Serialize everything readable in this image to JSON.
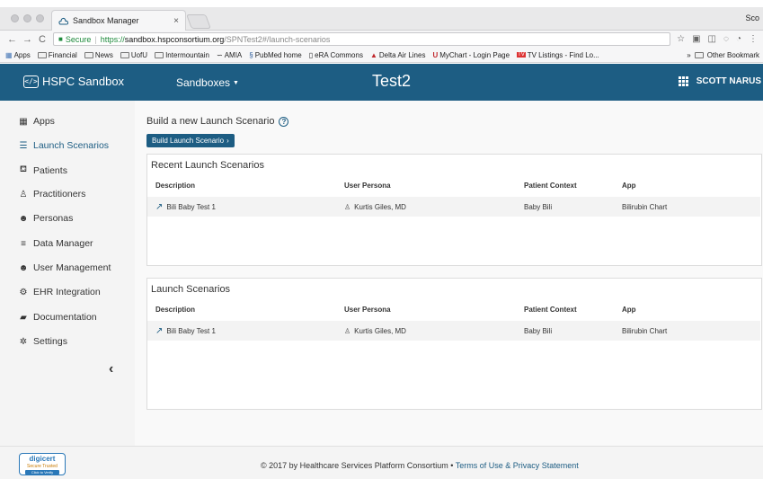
{
  "browser": {
    "tab_title": "Sandbox Manager",
    "tab_close": "×",
    "profile_label": "Sco",
    "nav": {
      "back": "←",
      "forward": "→",
      "reload": "C"
    },
    "address": {
      "secure_label": "Secure",
      "scheme": "https://",
      "host": "sandbox.hspconsortium.org",
      "path": "/SPNTest2#/launch-scenarios"
    },
    "bookmarks": [
      {
        "label": "Apps",
        "icon": "apps-grid-icon"
      },
      {
        "label": "Financial",
        "icon": "folder-icon"
      },
      {
        "label": "News",
        "icon": "folder-icon"
      },
      {
        "label": "UofU",
        "icon": "folder-icon"
      },
      {
        "label": "Intermountain",
        "icon": "folder-icon"
      },
      {
        "label": "AMIA",
        "icon": "amia-icon"
      },
      {
        "label": "PubMed home",
        "icon": "pubmed-icon"
      },
      {
        "label": "eRA Commons",
        "icon": "page-icon"
      },
      {
        "label": "Delta Air Lines",
        "icon": "delta-icon"
      },
      {
        "label": "MyChart - Login Page",
        "icon": "uofu-icon"
      },
      {
        "label": "TV Listings - Find Lo...",
        "icon": "tv-icon"
      }
    ],
    "bookmarks_overflow": "»",
    "other_bookmarks": "Other Bookmark"
  },
  "header": {
    "logo_text": "HSPC Sandbox",
    "sandboxes_label": "Sandboxes",
    "app_name": "Test2",
    "user_name": "SCOTT NARUS"
  },
  "sidebar": {
    "items": [
      {
        "label": "Apps",
        "icon": "apps-icon",
        "glyph": "▦"
      },
      {
        "label": "Launch Scenarios",
        "icon": "list-icon",
        "glyph": "☰"
      },
      {
        "label": "Patients",
        "icon": "bed-icon",
        "glyph": "⛾"
      },
      {
        "label": "Practitioners",
        "icon": "practitioner-icon",
        "glyph": "♙"
      },
      {
        "label": "Personas",
        "icon": "users-icon",
        "glyph": "☻"
      },
      {
        "label": "Data Manager",
        "icon": "database-icon",
        "glyph": "≡"
      },
      {
        "label": "User Management",
        "icon": "users-icon",
        "glyph": "☻"
      },
      {
        "label": "EHR Integration",
        "icon": "cogs-icon",
        "glyph": "⚙"
      },
      {
        "label": "Documentation",
        "icon": "book-icon",
        "glyph": "▰"
      },
      {
        "label": "Settings",
        "icon": "gear-icon",
        "glyph": "✲"
      }
    ],
    "active_index": 1,
    "collapse_glyph": "‹"
  },
  "main": {
    "build_title": "Build a new Launch Scenario",
    "help_glyph": "?",
    "build_button": "Build Launch Scenario",
    "build_button_glyph": "›",
    "columns": [
      "Description",
      "User Persona",
      "Patient Context",
      "App"
    ],
    "recent": {
      "title": "Recent Launch Scenarios",
      "rows": [
        {
          "description": "Bili Baby Test 1",
          "persona": "Kurtis Giles, MD",
          "patient": "Baby Bili",
          "app": "Bilirubin Chart"
        }
      ]
    },
    "all": {
      "title": "Launch Scenarios",
      "rows": [
        {
          "description": "Bili Baby Test 1",
          "persona": "Kurtis Giles, MD",
          "patient": "Baby Bili",
          "app": "Bilirubin Chart"
        }
      ]
    }
  },
  "footer": {
    "digicert_name": "digicert",
    "digicert_sub": "Secure Trusted",
    "digicert_click": "Click to Verify",
    "copyright": "© 2017 by Healthcare Services Platform Consortium •",
    "terms": "Terms of Use",
    "amp": "&",
    "privacy": "Privacy Statement"
  },
  "colors": {
    "brand": "#1d5d83",
    "sidebar_bg": "#f4f4f4",
    "row_bg": "#f3f3f3"
  }
}
